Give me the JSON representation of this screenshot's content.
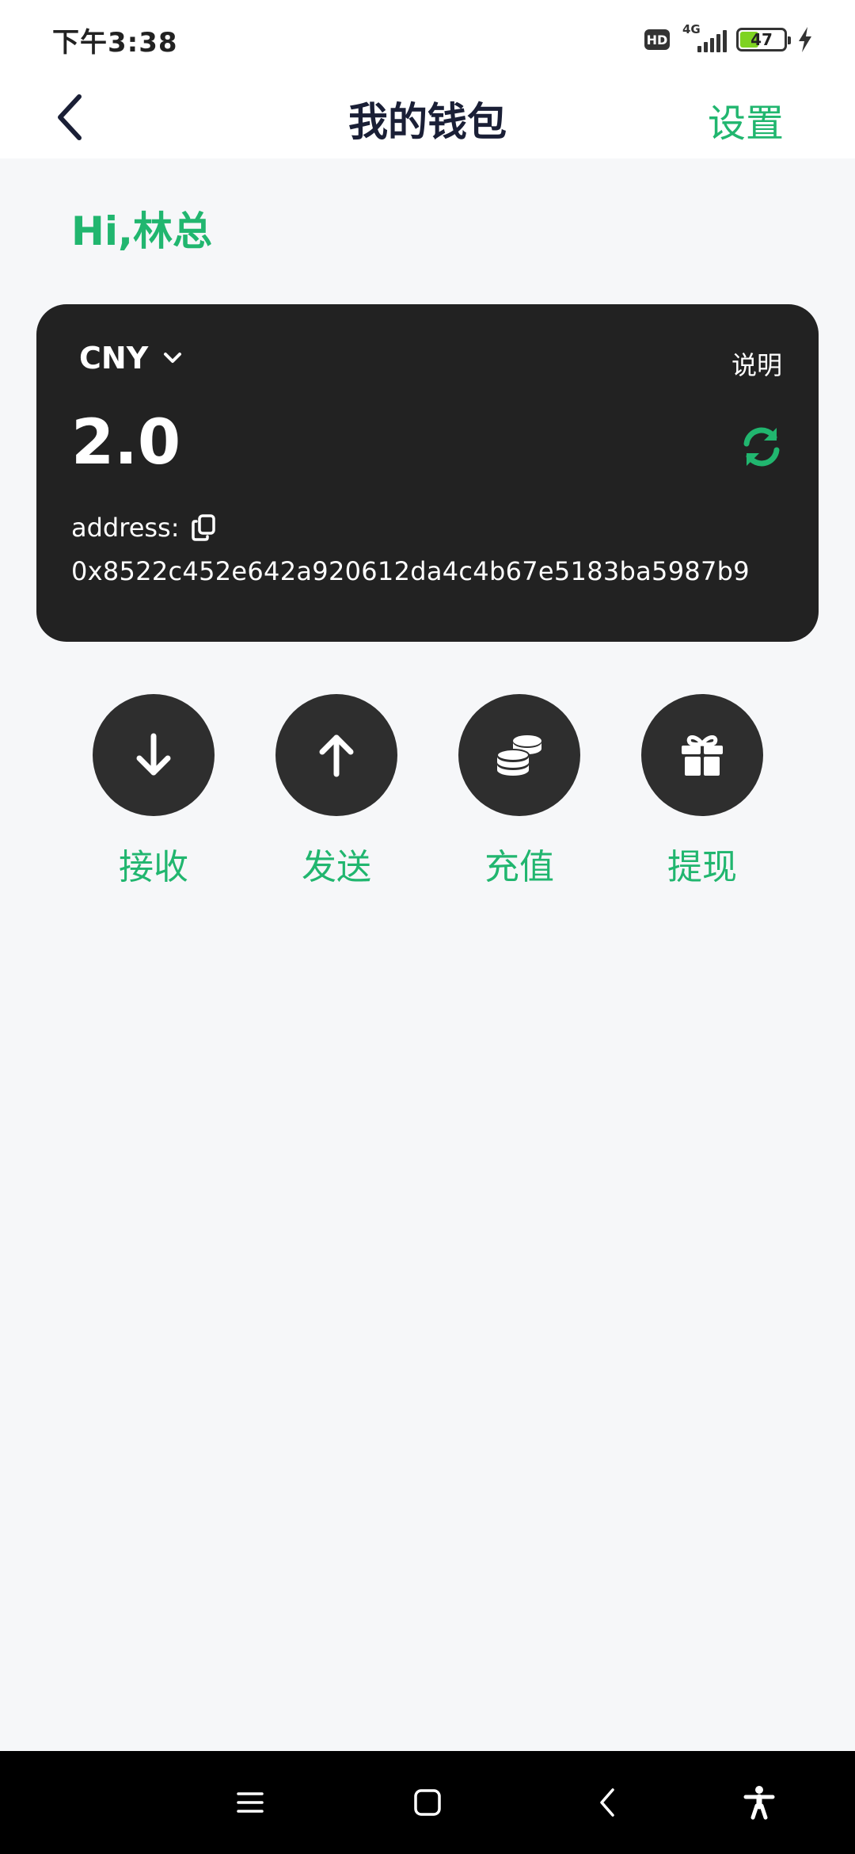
{
  "status_bar": {
    "time": "下午3:38",
    "hd_label": "HD",
    "network": "4G",
    "battery_level": "47",
    "battery_fraction": 0.47,
    "battery_color": "#7ed321",
    "charging_icon": "bolt-icon"
  },
  "header": {
    "title": "我的钱包",
    "back_icon": "chevron-left-icon",
    "settings_label": "设置"
  },
  "greeting": "Hi,林总",
  "wallet": {
    "currency": "CNY",
    "currency_icon": "chevron-down-icon",
    "explain_label": "说明",
    "balance": "2.0",
    "refresh_icon": "refresh-icon",
    "address_label": "address:",
    "copy_icon": "copy-icon",
    "address": "0x8522c452e642a920612da4c4b67e5183ba5987b9"
  },
  "actions": [
    {
      "label": "接收",
      "icon": "arrow-down-icon"
    },
    {
      "label": "发送",
      "icon": "arrow-up-icon"
    },
    {
      "label": "充值",
      "icon": "coins-icon"
    },
    {
      "label": "提现",
      "icon": "gift-icon"
    }
  ],
  "nav_bar": {
    "items": [
      "menu-icon",
      "home-icon",
      "back-icon",
      "accessibility-icon"
    ]
  },
  "colors": {
    "accent": "#21b66f",
    "card_bg": "#222222",
    "action_bg": "#2e2e2e",
    "page_bg": "#f6f7f9",
    "title": "#1a1f36"
  }
}
